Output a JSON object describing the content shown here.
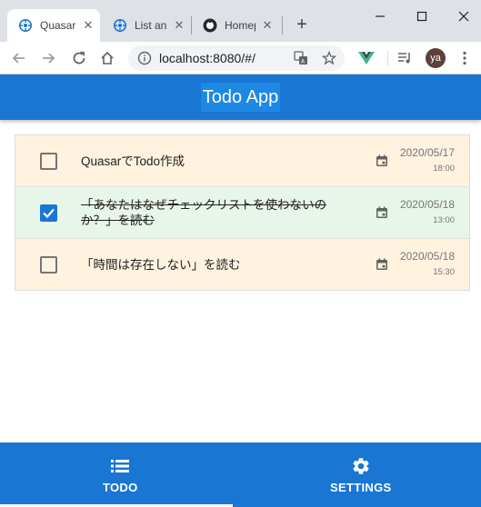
{
  "browser": {
    "tabs": [
      {
        "title": "Quasar",
        "active": true
      },
      {
        "title": "List an",
        "active": false
      },
      {
        "title": "Homep",
        "active": false
      }
    ],
    "url": "localhost:8080/#/",
    "avatar_initials": "ya"
  },
  "app": {
    "title": "Todo App",
    "accent": "#1976d2"
  },
  "todos": [
    {
      "text": "QuasarでTodo作成",
      "date": "2020/05/17",
      "time": "18:00",
      "done": false
    },
    {
      "text": "「あなたはなぜチェックリストを使わないのか？」を読む",
      "date": "2020/05/18",
      "time": "13:00",
      "done": true
    },
    {
      "text": "「時間は存在しない」を読む",
      "date": "2020/05/18",
      "time": "15:30",
      "done": false
    }
  ],
  "footer": {
    "tabs": [
      {
        "label": "TODO",
        "icon": "list-icon",
        "active": true
      },
      {
        "label": "SETTINGS",
        "icon": "gear-icon",
        "active": false
      }
    ]
  }
}
